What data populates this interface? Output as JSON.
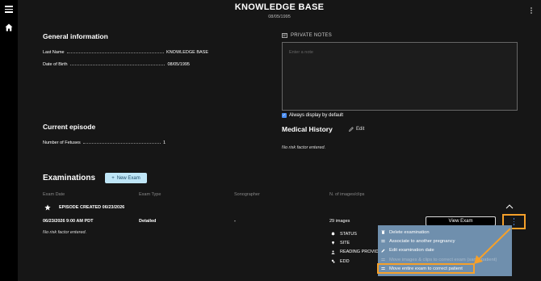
{
  "header": {
    "title": "KNOWLEDGE BASE",
    "date": "08/05/1995"
  },
  "general": {
    "title": "General information",
    "last_name_label": "Last Name",
    "last_name_value": "KNOWLEDGE BASE",
    "dob_label": "Date of Birth",
    "dob_value": "08/05/1995"
  },
  "notes": {
    "label": "PRIVATE NOTES",
    "placeholder": "Enter a note",
    "always_display": "Always display by default",
    "always_display_checked": true
  },
  "episode": {
    "title": "Current episode",
    "fetuses_label": "Number of Fetuses",
    "fetuses_value": "1"
  },
  "medical_history": {
    "title": "Medical History",
    "edit_label": "Edit",
    "note": "No risk factor entered."
  },
  "examinations": {
    "title": "Examinations",
    "new_exam_label": "New Exam",
    "columns": [
      "Exam Date",
      "Exam Type",
      "Sonographer",
      "N. of images/clips"
    ],
    "episode_label": "EPISODE CREATED 06/23/2026",
    "row": {
      "date": "06/23/2026 9:00 AM PDT",
      "type": "Detailed",
      "sonographer": "-",
      "images": "29 images",
      "note": "No risk factor entered.",
      "view_label": "View Exam"
    },
    "status_items": [
      "STATUS",
      "SITE",
      "READING PROVIDE",
      "EDD"
    ]
  },
  "context_menu": {
    "items": [
      {
        "label": "Delete examination",
        "icon": "trash-icon",
        "disabled": false
      },
      {
        "label": "Associate to another pregnancy",
        "icon": "link-icon",
        "disabled": false
      },
      {
        "label": "Edit examination date",
        "icon": "pencil-icon",
        "disabled": false
      },
      {
        "label": "Move images & clips to correct exam (same patient)",
        "icon": "move-icon",
        "disabled": true
      },
      {
        "label": "Move entire exam to correct patient",
        "icon": "move-icon",
        "disabled": false
      }
    ]
  },
  "colors": {
    "highlight": "#f5a02a",
    "accent": "#4a8ef2",
    "menu_bg": "#6f8fad",
    "new_exam_bg": "#bfe6f7"
  }
}
